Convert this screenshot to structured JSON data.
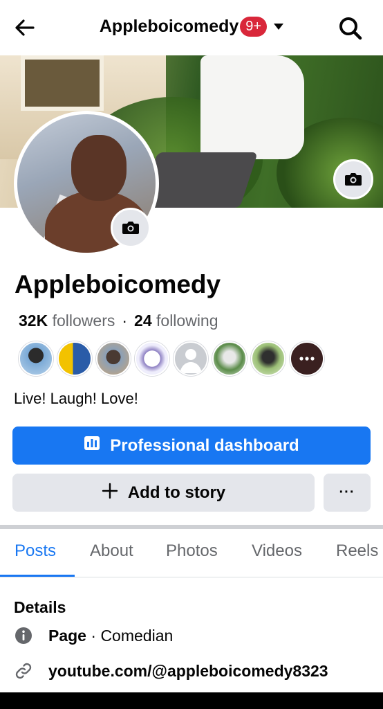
{
  "header": {
    "title": "Appleboicomedy",
    "notification_badge": "9+",
    "icons": [
      "back-arrow-icon",
      "chevron-down-icon",
      "search-icon"
    ]
  },
  "profile": {
    "name": "Appleboicomedy",
    "followers_count": "32K",
    "followers_label": "followers",
    "separator": "·",
    "following_count": "24",
    "following_label": "following",
    "bio": "Live! Laugh! Love!"
  },
  "actions": {
    "professional_dashboard": "Professional dashboard",
    "add_to_story": "Add to story",
    "more": "···"
  },
  "tabs": [
    {
      "label": "Posts",
      "active": true
    },
    {
      "label": "About",
      "active": false
    },
    {
      "label": "Photos",
      "active": false
    },
    {
      "label": "Videos",
      "active": false
    },
    {
      "label": "Reels",
      "active": false
    }
  ],
  "details": {
    "heading": "Details",
    "page_label": "Page",
    "page_separator": " · ",
    "page_category": "Comedian",
    "link": "youtube.com/@appleboicomedy8323"
  },
  "colors": {
    "accent": "#1877f2",
    "badge": "#d9273a",
    "button_secondary": "#e4e6eb"
  }
}
